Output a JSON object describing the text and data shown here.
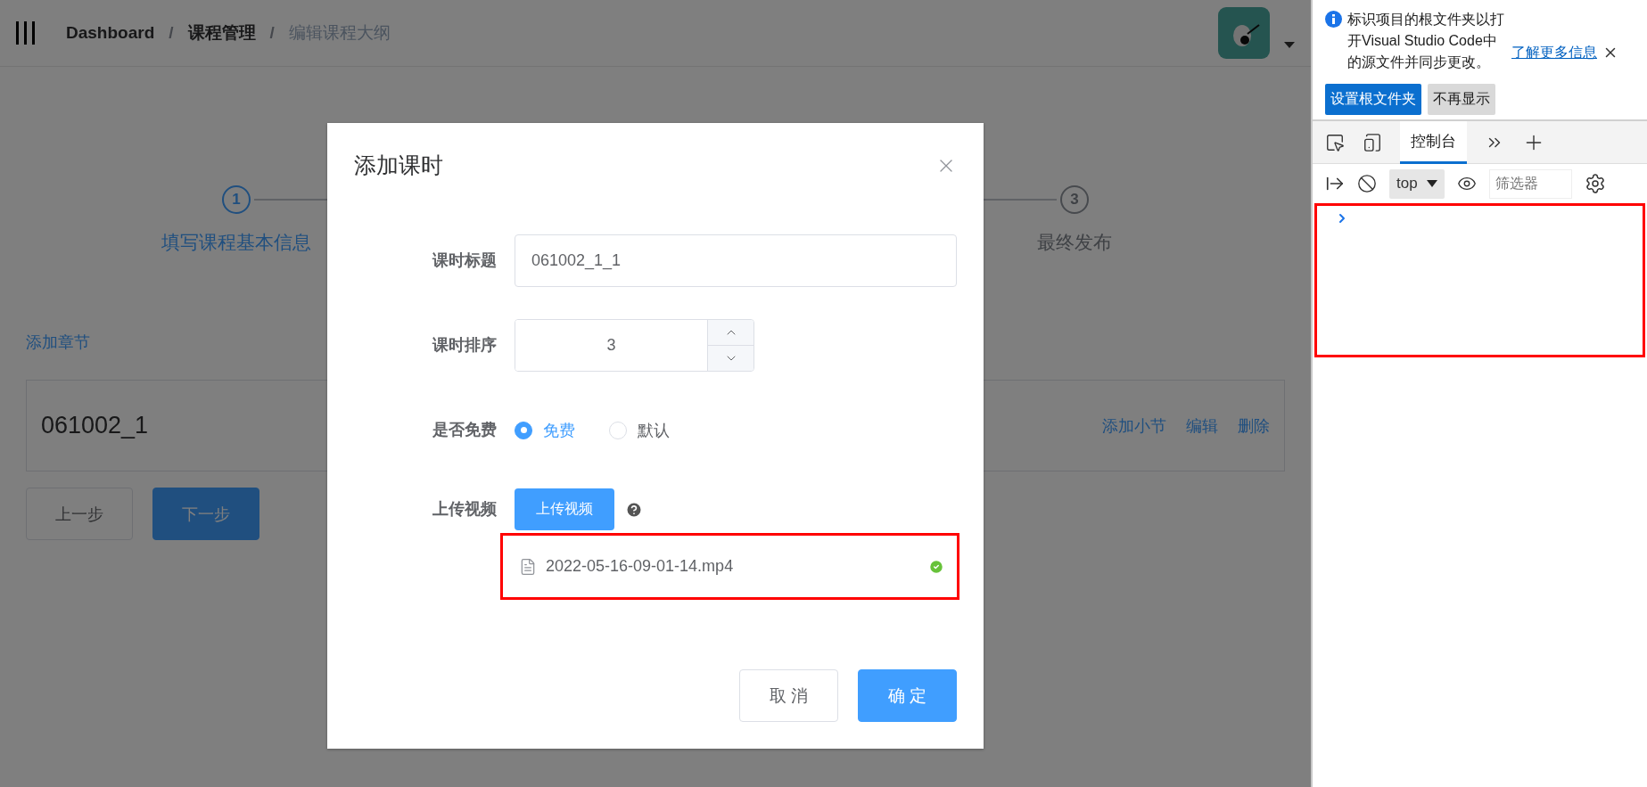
{
  "header": {
    "breadcrumbs": [
      {
        "label": "Dashboard",
        "current": false
      },
      {
        "label": "课程管理",
        "current": false
      },
      {
        "label": "编辑课程大纲",
        "current": true
      }
    ],
    "separator": "/"
  },
  "steps": [
    {
      "number": "1",
      "label": "填写课程基本信息",
      "selected": true
    },
    {
      "number": "3",
      "label": "最终发布",
      "selected": false
    }
  ],
  "add_chapter": "添加章节",
  "chapters": [
    {
      "title": "061002_1",
      "actions": [
        "添加小节",
        "编辑",
        "删除"
      ]
    }
  ],
  "nav_buttons": [
    {
      "label": "上一步",
      "primary": false
    },
    {
      "label": "下一步",
      "primary": true
    }
  ],
  "dialog": {
    "title": "添加课时",
    "fields": [
      {
        "kind": "text",
        "label": "课时标题",
        "value": "061002_1_1"
      },
      {
        "kind": "number",
        "label": "课时排序",
        "value": "3"
      },
      {
        "kind": "radio",
        "label": "是否免费",
        "options": [
          {
            "label": "免费",
            "selected": true
          },
          {
            "label": "默认",
            "selected": false
          }
        ]
      },
      {
        "kind": "upload",
        "label": "上传视频",
        "button": "上传视频",
        "files": [
          {
            "name": "2022-05-16-09-01-14.mp4",
            "highlighted": true
          }
        ]
      }
    ],
    "buttons": [
      {
        "label": "取 消",
        "primary": false
      },
      {
        "label": "确 定",
        "primary": true
      }
    ]
  },
  "devtools": {
    "infobar": {
      "message": "标识项目的根文件夹以打开Visual Studio Code中的源文件并同步更改。",
      "link": "了解更多信息",
      "buttons": [
        {
          "label": "设置根文件夹",
          "primary": true
        },
        {
          "label": "不再显示",
          "primary": false
        }
      ]
    },
    "tabs": [
      {
        "label": "控制台",
        "selected": true
      }
    ],
    "context": "top",
    "filter_placeholder": "筛选器",
    "console_highlighted": true
  }
}
